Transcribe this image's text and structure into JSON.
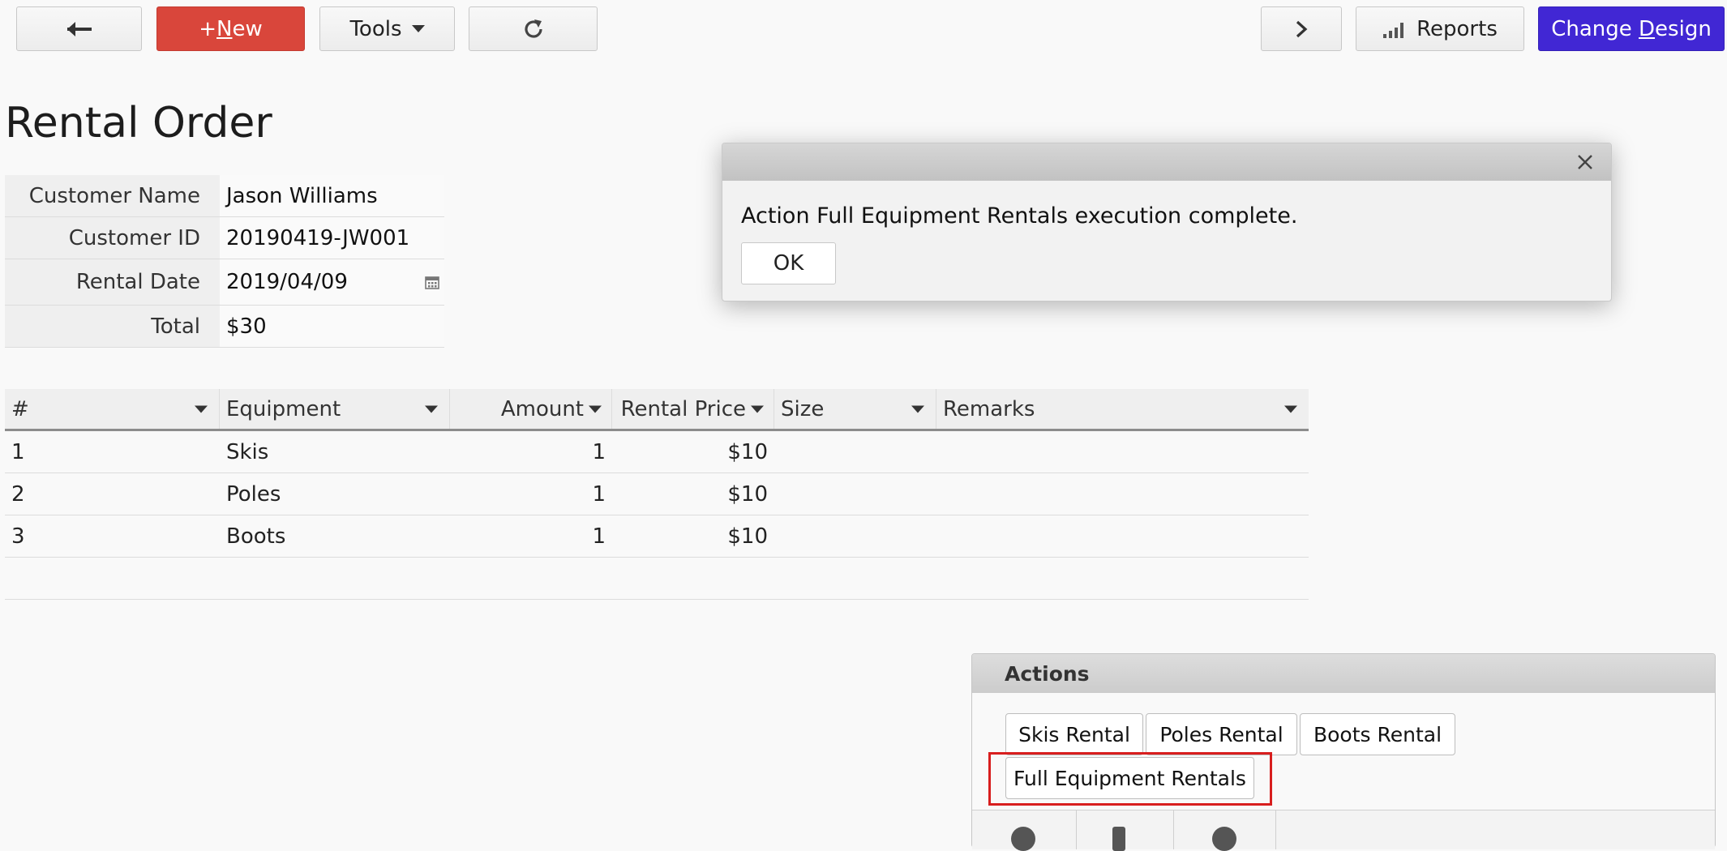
{
  "toolbar": {
    "new_prefix": "+",
    "new_underlined": "N",
    "new_rest": "ew",
    "tools_label": "Tools",
    "reports_label": "Reports",
    "change_design_prefix": "Change ",
    "change_design_underlined": "D",
    "change_design_rest": "esign"
  },
  "page": {
    "title": "Rental Order"
  },
  "form": {
    "customer_name_label": "Customer Name",
    "customer_name_value": "Jason Williams",
    "customer_id_label": "Customer ID",
    "customer_id_value": "20190419-JW001",
    "rental_date_label": "Rental Date",
    "rental_date_value": "2019/04/09",
    "total_label": "Total",
    "total_value": "$30"
  },
  "grid": {
    "columns": [
      "#",
      "Equipment",
      "Amount",
      "Rental Price",
      "Size",
      "Remarks"
    ],
    "rows": [
      {
        "no": "1",
        "equipment": "Skis",
        "amount": "1",
        "price": "$10",
        "size": "",
        "remarks": ""
      },
      {
        "no": "2",
        "equipment": "Poles",
        "amount": "1",
        "price": "$10",
        "size": "",
        "remarks": ""
      },
      {
        "no": "3",
        "equipment": "Boots",
        "amount": "1",
        "price": "$10",
        "size": "",
        "remarks": ""
      }
    ]
  },
  "dialog": {
    "message": "Action Full Equipment Rentals execution complete.",
    "ok_label": "OK"
  },
  "actions": {
    "title": "Actions",
    "buttons": [
      "Skis Rental",
      "Poles Rental",
      "Boots Rental",
      "Full Equipment Rentals"
    ]
  },
  "colors": {
    "new_button": "#d9463b",
    "change_design_button": "#4127d4",
    "highlight_box": "#d81e1e"
  }
}
